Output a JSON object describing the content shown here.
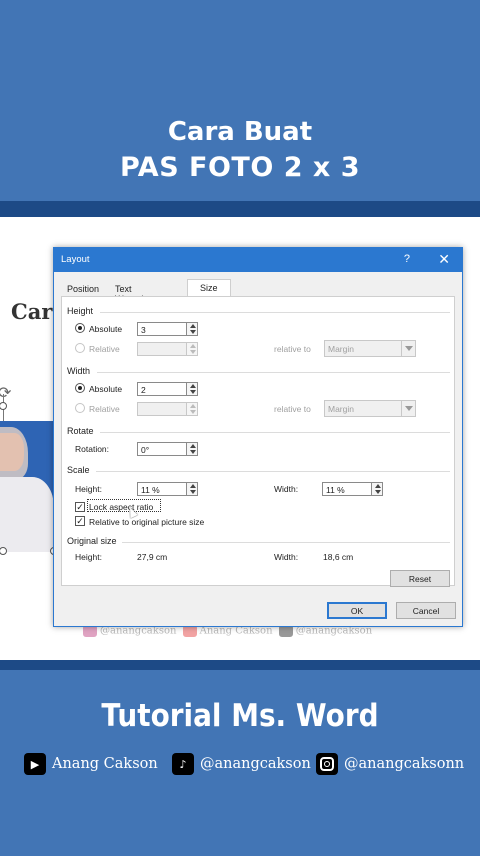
{
  "header": {
    "line1": "Cara Buat",
    "line2": "PAS FOTO 2 x 3"
  },
  "document": {
    "title_partial": "Cara",
    "watermark": {
      "instagram": "@anangcakson",
      "youtube": "Anang Cakson",
      "tiktok": "@anangcakson"
    }
  },
  "dialog": {
    "title": "Layout",
    "help": "?",
    "close": "✕",
    "tabs": [
      {
        "label": "Position",
        "active": false
      },
      {
        "label": "Text Wrapping",
        "active": false
      },
      {
        "label": "Size",
        "active": true
      }
    ],
    "height": {
      "section": "Height",
      "absolute_label": "Absolute",
      "absolute_value": "3",
      "relative_label": "Relative",
      "relative_to_label": "relative to",
      "relative_to_value": "Margin"
    },
    "width": {
      "section": "Width",
      "absolute_label": "Absolute",
      "absolute_value": "2",
      "relative_label": "Relative",
      "relative_to_label": "relative to",
      "relative_to_value": "Margin"
    },
    "rotate": {
      "section": "Rotate",
      "rotation_label": "Rotation:",
      "rotation_value": "0°"
    },
    "scale": {
      "section": "Scale",
      "height_label": "Height:",
      "height_value": "11 %",
      "width_label": "Width:",
      "width_value": "11 %",
      "lock_aspect_label": "Lock aspect ratio",
      "lock_aspect_checked": true,
      "relative_original_label": "Relative to original picture size",
      "relative_original_checked": true
    },
    "original_size": {
      "section": "Original size",
      "height_label": "Height:",
      "height_value": "27,9 cm",
      "width_label": "Width:",
      "width_value": "18,6 cm"
    },
    "buttons": {
      "reset": "Reset",
      "ok": "OK",
      "cancel": "Cancel"
    }
  },
  "footer": {
    "subtitle": "Tutorial Ms. Word",
    "youtube": "Anang Cakson",
    "tiktok": "@anangcakson",
    "instagram": "@anangcaksonn"
  },
  "colors": {
    "background": "#4275b5",
    "band": "#1d4a86",
    "dialog_titlebar": "#2b78d0"
  }
}
